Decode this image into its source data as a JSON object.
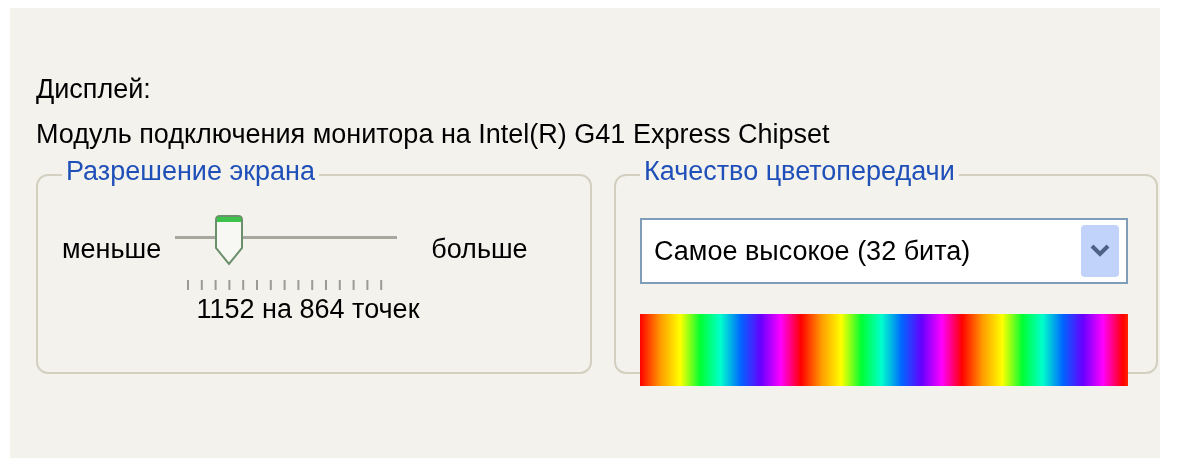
{
  "display_label": "Дисплей:",
  "display_device": "Модуль подключения монитора на Intel(R) G41 Express Chipset",
  "resolution": {
    "title": "Разрешение экрана",
    "min_label": "меньше",
    "max_label": "больше",
    "level": 0.25,
    "reading": "1152 на 864 точек"
  },
  "color_quality": {
    "title": "Качество цветопередачи",
    "value": "Самое высокое (32 бита)"
  }
}
